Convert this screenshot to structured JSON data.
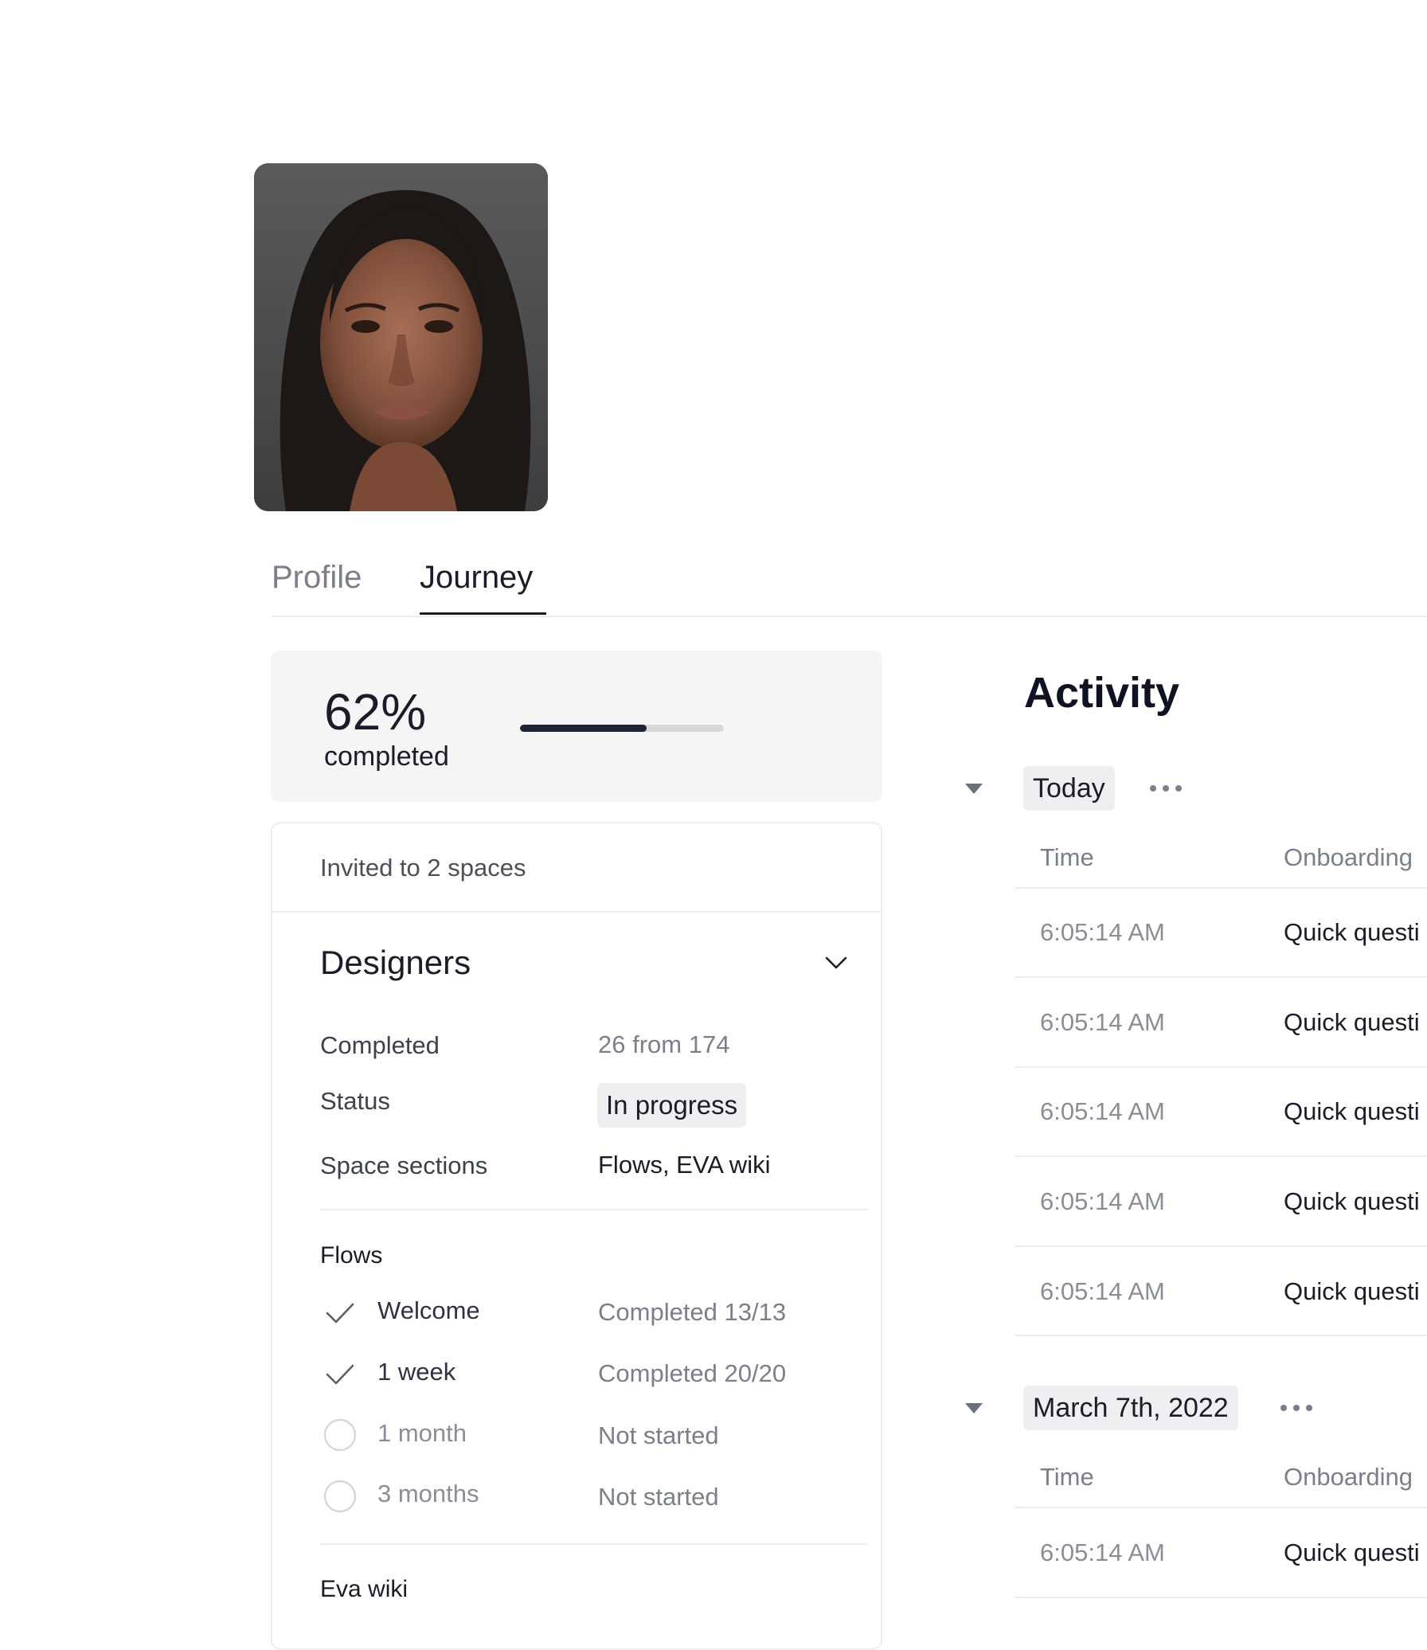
{
  "tabs": [
    {
      "label": "Profile",
      "active": false
    },
    {
      "label": "Journey",
      "active": true
    }
  ],
  "progress": {
    "percent_label": "62%",
    "caption": "completed",
    "fraction": 0.62
  },
  "spaces": {
    "invited": "Invited to 2 spaces",
    "group": {
      "title": "Designers",
      "chevron_icon": "chevron-down-icon",
      "details": [
        {
          "label": "Completed",
          "value": "26 from 174"
        },
        {
          "label": "Status",
          "value": "In progress"
        },
        {
          "label": "Space sections",
          "value": "Flows, EVA wiki"
        }
      ],
      "flows_title": "Flows",
      "flows": [
        {
          "name": "Welcome",
          "status": "Completed 13/13",
          "icon": "check-icon"
        },
        {
          "name": "1 week",
          "status": "Completed 20/20",
          "icon": "check-icon"
        },
        {
          "name": "1 month",
          "status": "Not started",
          "icon": "empty-circle-icon"
        },
        {
          "name": "3 months",
          "status": "Not started",
          "icon": "empty-circle-icon"
        }
      ],
      "wiki_title": "Eva wiki"
    }
  },
  "activity": {
    "title": "Activity",
    "groups": [
      {
        "date": "Today",
        "columns": [
          "Time",
          "Onboarding"
        ],
        "rows": [
          {
            "time": "6:05:14 AM",
            "item": "Quick questi"
          },
          {
            "time": "6:05:14 AM",
            "item": "Quick questi"
          },
          {
            "time": "6:05:14 AM",
            "item": "Quick questi"
          },
          {
            "time": "6:05:14 AM",
            "item": "Quick questi"
          },
          {
            "time": "6:05:14 AM",
            "item": "Quick questi"
          }
        ]
      },
      {
        "date": "March 7th, 2022",
        "columns": [
          "Time",
          "Onboarding"
        ],
        "rows": [
          {
            "time": "6:05:14 AM",
            "item": "Quick questi"
          }
        ]
      }
    ]
  },
  "colors": {
    "accent": "#1f2233",
    "muted": "#7b7f8c",
    "chip": "#efeff1"
  }
}
